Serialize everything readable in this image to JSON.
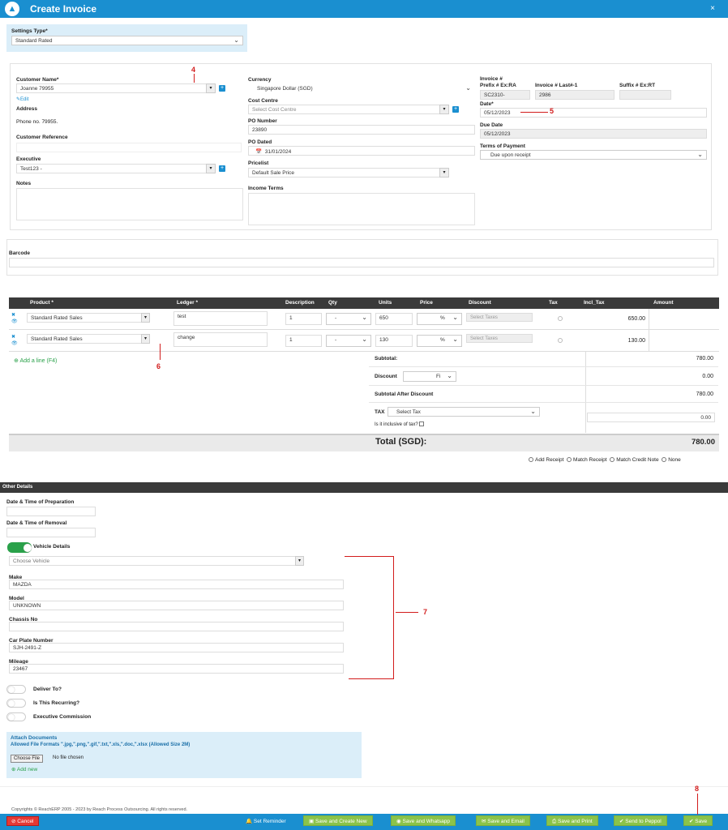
{
  "header": {
    "title": "Create Invoice",
    "close": "×"
  },
  "settings": {
    "label": "Settings Type*",
    "value": "Standard Rated"
  },
  "customer": {
    "name_label": "Customer Name*",
    "name_value": "Joanne            79955",
    "edit_link": "Edit",
    "address_label": "Address",
    "address_value": "Phone no. 79955.",
    "ref_label": "Customer Reference",
    "exec_label": "Executive",
    "exec_value": "Test123 -",
    "notes_label": "Notes"
  },
  "middle": {
    "currency_label": "Currency",
    "currency_value": "Singapore Dollar (SGD)",
    "cost_label": "Cost Centre",
    "cost_placeholder": "Select Cost Centre",
    "po_label": "PO Number",
    "po_value": "23890",
    "pod_label": "PO Dated",
    "pod_value": "31/01/2024",
    "pricelist_label": "Pricelist",
    "pricelist_value": "Default Sale Price",
    "income_label": "Income Terms"
  },
  "invoice": {
    "label": "Invoice #",
    "prefix_label": "Prefix # Ex:RA",
    "prefix_value": "SC2310-",
    "last_label": "Invoice # Last#-1",
    "last_value": "2986",
    "suffix_label": "Suffix # Ex:RT",
    "date_label": "Date*",
    "date_value": "05/12/2023",
    "due_label": "Due Date",
    "due_value": "05/12/2023",
    "terms_label": "Terms of Payment",
    "terms_value": "Due upon receipt"
  },
  "barcode": {
    "label": "Barcode"
  },
  "table": {
    "headers": [
      "Product *",
      "Ledger *",
      "Description",
      "Qty",
      "Units",
      "Price",
      "Discount",
      "Tax",
      "Incl_Tax",
      "Amount"
    ],
    "rows": [
      {
        "product": "Standard Rated Sales",
        "ledger": "test",
        "qty": "1",
        "units": "-",
        "price": "650",
        "disc_unit": "%",
        "tax": "Select Taxes",
        "amount": "650.00"
      },
      {
        "product": "Standard Rated Sales",
        "ledger": "change",
        "qty": "1",
        "units": "-",
        "price": "130",
        "disc_unit": "%",
        "tax": "Select Taxes",
        "amount": "130.00"
      }
    ],
    "add_line": "Add a line (F4)"
  },
  "totals": {
    "subtotal_label": "Subtotal:",
    "subtotal": "780.00",
    "discount_label": "Discount",
    "discount_unit": "Fi",
    "discount": "0.00",
    "after_label": "Subtotal After Discount",
    "after": "780.00",
    "tax_label": "TAX",
    "tax_select": "Select Tax",
    "tax_value": "0.00",
    "inclusive": "Is it inclusive of tax?",
    "total_label": "Total (SGD):",
    "total": "780.00"
  },
  "receipt_options": [
    "Add Receipt",
    "Match Receipt",
    "Match Credit Note",
    "None"
  ],
  "other": {
    "title": "Other Details",
    "prep_label": "Date & Time of Preparation",
    "removal_label": "Date & Time of Removal",
    "vehicle_label": "Vehicle Details",
    "vehicle_placeholder": "Choose Vehicle",
    "make_label": "Make",
    "make_value": "MAZDA",
    "model_label": "Model",
    "model_value": "UNKNOWN",
    "chassis_label": "Chassis No",
    "plate_label": "Car Plate Number",
    "plate_value": "SJH-2491-Z",
    "mileage_label": "Mileage",
    "mileage_value": "23467",
    "deliver_label": "Deliver To?",
    "recurring_label": "Is This Recurring?",
    "commission_label": "Executive Commission"
  },
  "attach": {
    "title": "Attach Documents",
    "formats": "Allowed File Formats \".jpg,\".png,\".gif,\".txt,\".xls,\".doc,\".xlsx (Allowed Size 2M)",
    "choose": "Choose File",
    "nofile": "No file chosen",
    "add_new": "Add new"
  },
  "footer": {
    "copyright": "Copyrights © ReachERP 2005 - 2023 by Reach Process Outsourcing. All rights reserved.",
    "cancel": "Cancel",
    "reminder": "Set Reminder",
    "save_create": "Save and Create New",
    "save_whatsapp": "Save and Whatsapp",
    "save_email": "Save and Email",
    "save_print": "Save and Print",
    "peppol": "Send to Peppol",
    "save": "Save"
  },
  "annotations": [
    "4",
    "5",
    "6",
    "7",
    "8"
  ],
  "colors": {
    "header": "#1a8fd0",
    "table_header": "#3a3a3a",
    "button_green": "#8bc34a",
    "cancel_red": "#e53935"
  }
}
